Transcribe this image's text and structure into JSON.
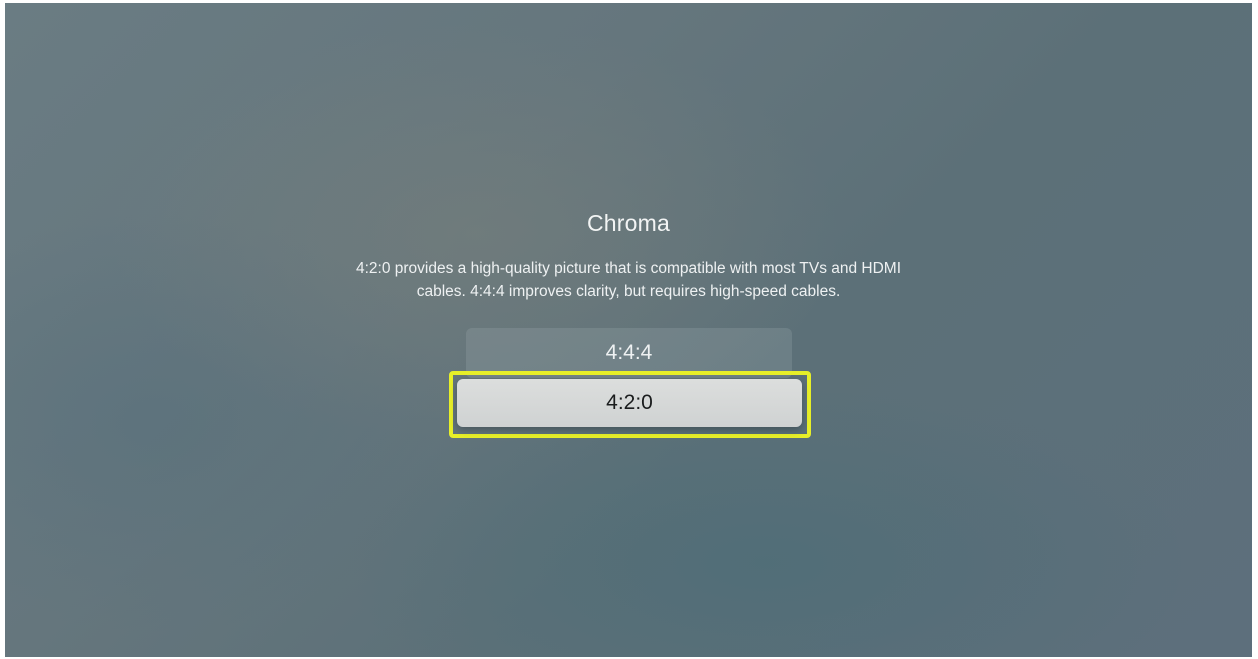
{
  "screen": {
    "title": "Chroma",
    "description_line1": "4:2:0 provides a high-quality picture that is compatible with most TVs and HDMI",
    "description_line2": "cables. 4:4:4 improves clarity, but requires high-speed cables."
  },
  "options": [
    {
      "label": "4:4:4",
      "selected": false
    },
    {
      "label": "4:2:0",
      "selected": true
    }
  ],
  "colors": {
    "highlight": "#e7ef29",
    "selected_bg": "#d6d8d8"
  }
}
